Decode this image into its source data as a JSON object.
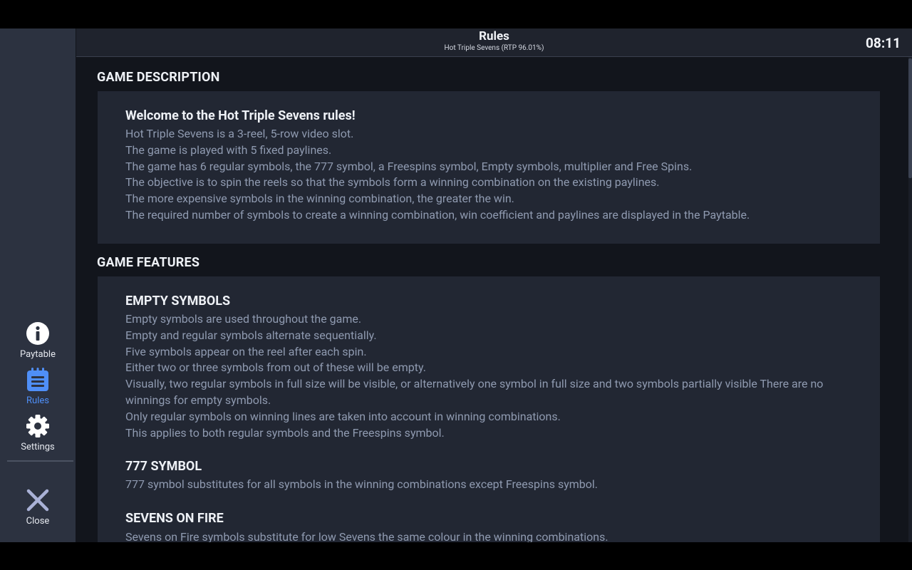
{
  "header": {
    "title": "Rules",
    "subtitle": "Hot Triple Sevens (RTP 96.01%)",
    "clock": "08:11"
  },
  "sidebar": {
    "items": [
      {
        "label": "Paytable",
        "icon": "info-icon"
      },
      {
        "label": "Rules",
        "icon": "rules-icon",
        "active": true
      },
      {
        "label": "Settings",
        "icon": "gear-icon"
      },
      {
        "label": "Close",
        "icon": "close-icon"
      }
    ]
  },
  "sections": {
    "description": {
      "title": "GAME DESCRIPTION",
      "heading": "Welcome to the Hot Triple Sevens rules!",
      "lines": [
        "Hot Triple Sevens is a 3-reel, 5-row video slot.",
        "The game is played with 5 fixed paylines.",
        "The game has 6 regular symbols, the 777 symbol, a Freespins symbol, Empty symbols, multiplier and Free Spins.",
        "The objective is to spin the reels so that the symbols form a winning combination on the existing paylines.",
        "The more expensive symbols in the winning combination, the greater the win.",
        "The required number of symbols to create a winning combination, win coefficient and paylines are displayed in the Paytable."
      ]
    },
    "features": {
      "title": "GAME FEATURES",
      "empty_symbols": {
        "heading": "EMPTY SYMBOLS",
        "lines": [
          "Empty symbols are used throughout the game.",
          "Empty and regular symbols alternate sequentially.",
          "Five symbols appear on the reel after each spin.",
          "Either two or three symbols from out of these will be empty.",
          "Visually, two regular symbols in full size will be visible, or alternatively one symbol in full size and two symbols partially visible There are no winnings for empty symbols.",
          "Only regular symbols on winning lines are taken into account in winning combinations.",
          "This applies to both regular symbols and the Freespins symbol."
        ]
      },
      "symbol_777": {
        "heading": "777 SYMBOL",
        "lines": [
          "777 symbol substitutes for all symbols in the winning combinations except Freespins symbol."
        ]
      },
      "sevens_on_fire": {
        "heading": "SEVENS ON FIRE",
        "lines": [
          "Sevens on Fire symbols substitute for low Sevens the same colour in the winning combinations."
        ]
      }
    }
  },
  "colors": {
    "accent": "#4f8ff7",
    "sidebar_bg": "#2c3240",
    "panel_bg": "#222733",
    "content_bg": "#12151c",
    "body_text": "#8f9ab0"
  }
}
